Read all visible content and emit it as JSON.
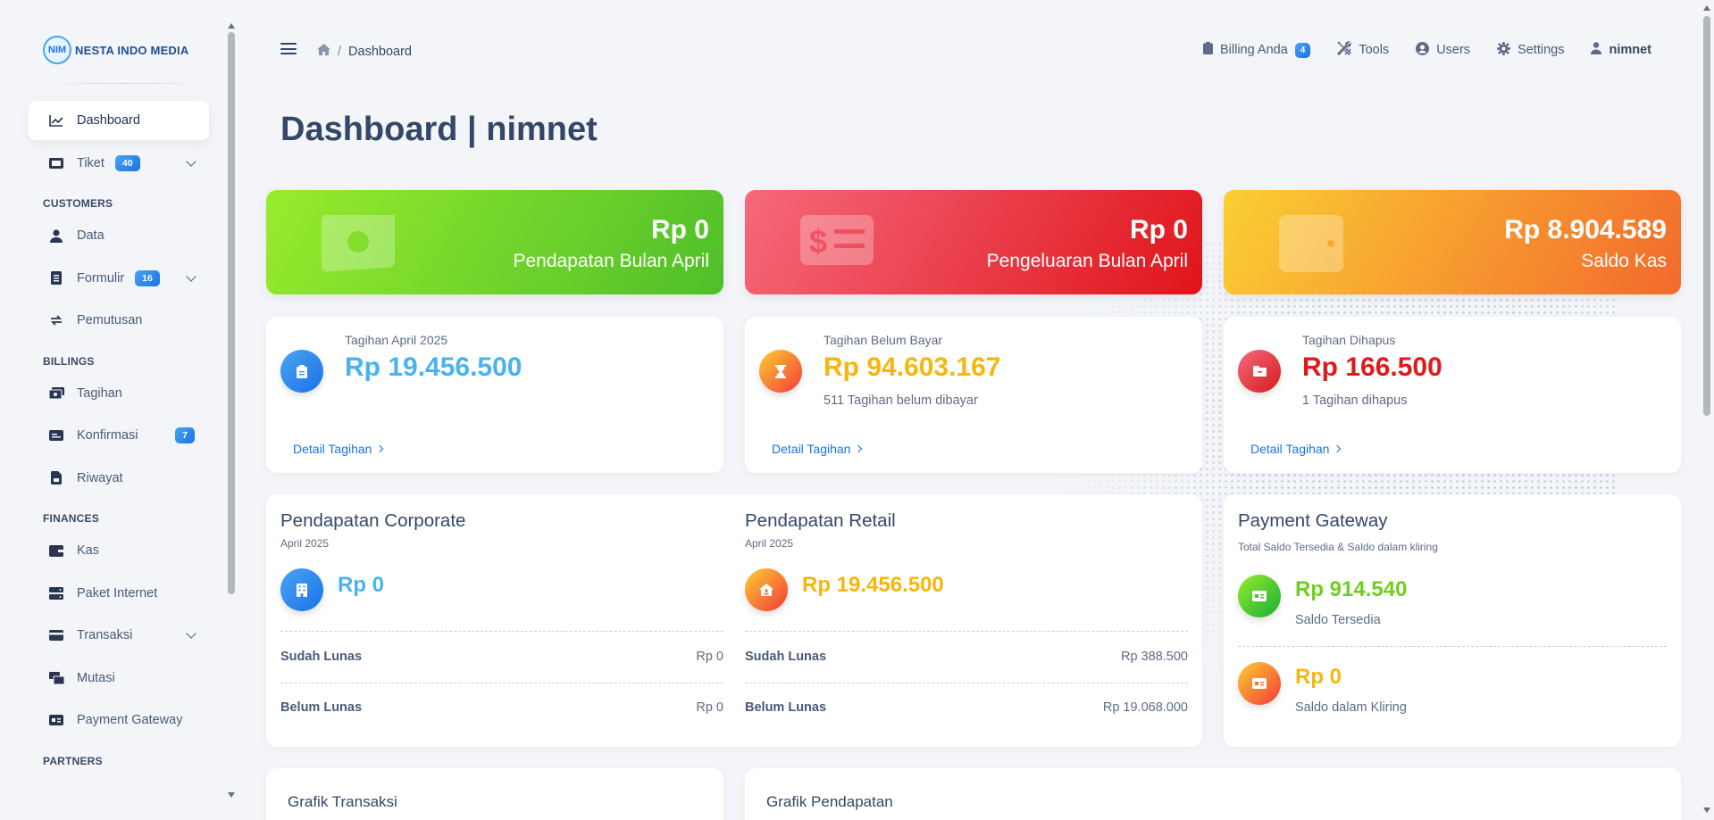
{
  "logo": {
    "mark": "NIM",
    "text": "NESTA INDO MEDIA"
  },
  "sidebar": {
    "dashboard": "Dashboard",
    "tiket": {
      "label": "Tiket",
      "badge": "40"
    },
    "sec_customers": "CUSTOMERS",
    "data": "Data",
    "formulir": {
      "label": "Formulir",
      "badge": "16"
    },
    "pemutusan": "Pemutusan",
    "sec_billings": "BILLINGS",
    "tagihan": "Tagihan",
    "konfirmasi": {
      "label": "Konfirmasi",
      "badge": "7"
    },
    "riwayat": "Riwayat",
    "sec_finances": "FINANCES",
    "kas": "Kas",
    "paket": "Paket Internet",
    "transaksi": "Transaksi",
    "mutasi": "Mutasi",
    "pg": "Payment Gateway",
    "sec_partners": "PARTNERS"
  },
  "breadcrumb": {
    "current": "Dashboard"
  },
  "topnav": {
    "billing": "Billing Anda",
    "billing_badge": "4",
    "tools": "Tools",
    "users": "Users",
    "settings": "Settings",
    "user": "nimnet"
  },
  "page_title": "Dashboard | nimnet",
  "summary": {
    "pendapatan": {
      "value": "Rp 0",
      "label": "Pendapatan Bulan April",
      "icon": "money-bill-icon",
      "color": "#4fbf2a"
    },
    "pengeluaran": {
      "value": "Rp 0",
      "label": "Pengeluaran Bulan April",
      "icon": "money-check-icon",
      "color": "#e0141a"
    },
    "saldo": {
      "value": "Rp 8.904.589",
      "label": "Saldo Kas",
      "icon": "wallet-icon",
      "color": "#f26a2c"
    }
  },
  "stats": {
    "tagihan": {
      "label": "Tagihan April 2025",
      "value": "Rp 19.456.500",
      "link": "Detail Tagihan"
    },
    "belum": {
      "label": "Tagihan Belum Bayar",
      "value": "Rp 94.603.167",
      "note": "511 Tagihan belum dibayar",
      "link": "Detail Tagihan"
    },
    "dihapus": {
      "label": "Tagihan Dihapus",
      "value": "Rp 166.500",
      "note": "1 Tagihan dihapus",
      "link": "Detail Tagihan"
    }
  },
  "corporate": {
    "title": "Pendapatan Corporate",
    "date": "April 2025",
    "amount": "Rp 0",
    "lunas_label": "Sudah Lunas",
    "lunas_value": "Rp 0",
    "belum_label": "Belum Lunas",
    "belum_value": "Rp 0"
  },
  "retail": {
    "title": "Pendapatan Retail",
    "date": "April 2025",
    "amount": "Rp 19.456.500",
    "lunas_label": "Sudah Lunas",
    "lunas_value": "Rp 388.500",
    "belum_label": "Belum Lunas",
    "belum_value": "Rp 19.068.000"
  },
  "payment_gateway": {
    "title": "Payment Gateway",
    "subtitle": "Total Saldo Tersedia & Saldo dalam kliring",
    "tersedia_value": "Rp 914.540",
    "tersedia_label": "Saldo Tersedia",
    "kliring_value": "Rp 0",
    "kliring_label": "Saldo dalam Kliring"
  },
  "charts": {
    "transaksi": "Grafik Transaksi",
    "pendapatan": "Grafik Pendapatan"
  }
}
